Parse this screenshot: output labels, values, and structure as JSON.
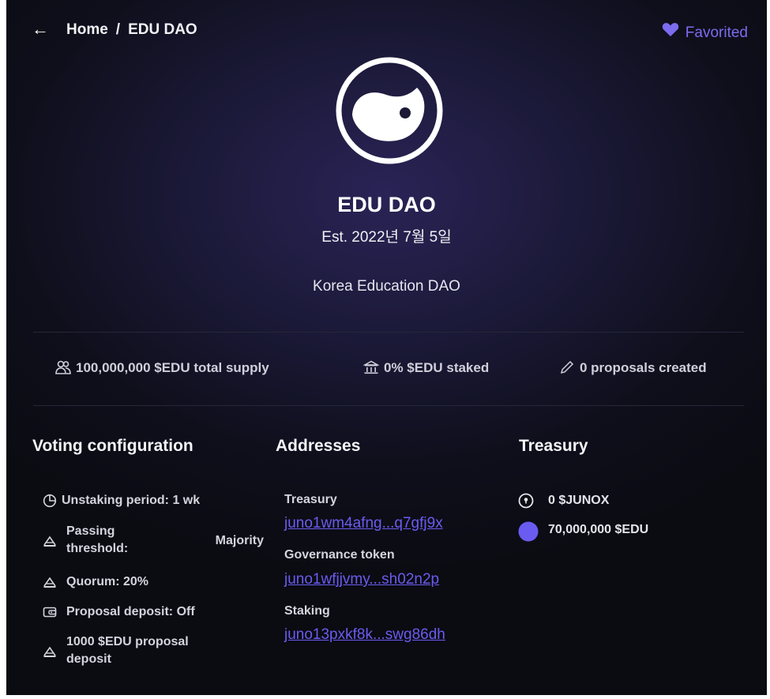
{
  "nav": {
    "back_icon": "arrow-left-icon",
    "home": "Home",
    "separator": "/",
    "current": "EDU DAO",
    "favorite": "Favorited",
    "favorite_color": "#7b6cf0"
  },
  "dao": {
    "logo_icon": "yin-yang-icon",
    "name": "EDU DAO",
    "established": "Est. 2022년 7월 5일",
    "description": "Korea Education DAO"
  },
  "stats": [
    {
      "icon": "users-icon",
      "text": "100,000,000 $EDU total supply"
    },
    {
      "icon": "bank-icon",
      "text": "0% $EDU staked"
    },
    {
      "icon": "pencil-icon",
      "text": "0 proposals created"
    }
  ],
  "voting": {
    "title": "Voting configuration",
    "unstaking": "Unstaking period: 1 wk",
    "passing_label": "Passing threshold:",
    "passing_value": "Majority",
    "quorum": "Quorum: 20%",
    "proposal_deposit": "Proposal deposit: Off",
    "deposit_amount": "1000 $EDU proposal deposit"
  },
  "addresses": {
    "title": "Addresses",
    "items": [
      {
        "label": "Treasury",
        "value": "juno1wm4afng...q7gfj9x"
      },
      {
        "label": "Governance token",
        "value": "juno1wfjjvmy...sh02n2p"
      },
      {
        "label": "Staking",
        "value": "juno13pxkf8k...swg86dh"
      }
    ],
    "link_color": "#6a5cf0"
  },
  "treasury": {
    "title": "Treasury",
    "items": [
      {
        "icon": "junox-token-icon",
        "text": "0 $JUNOX"
      },
      {
        "icon": "edu-token-icon",
        "text": "70,000,000 $EDU",
        "color": "#6a5cf0"
      }
    ]
  }
}
